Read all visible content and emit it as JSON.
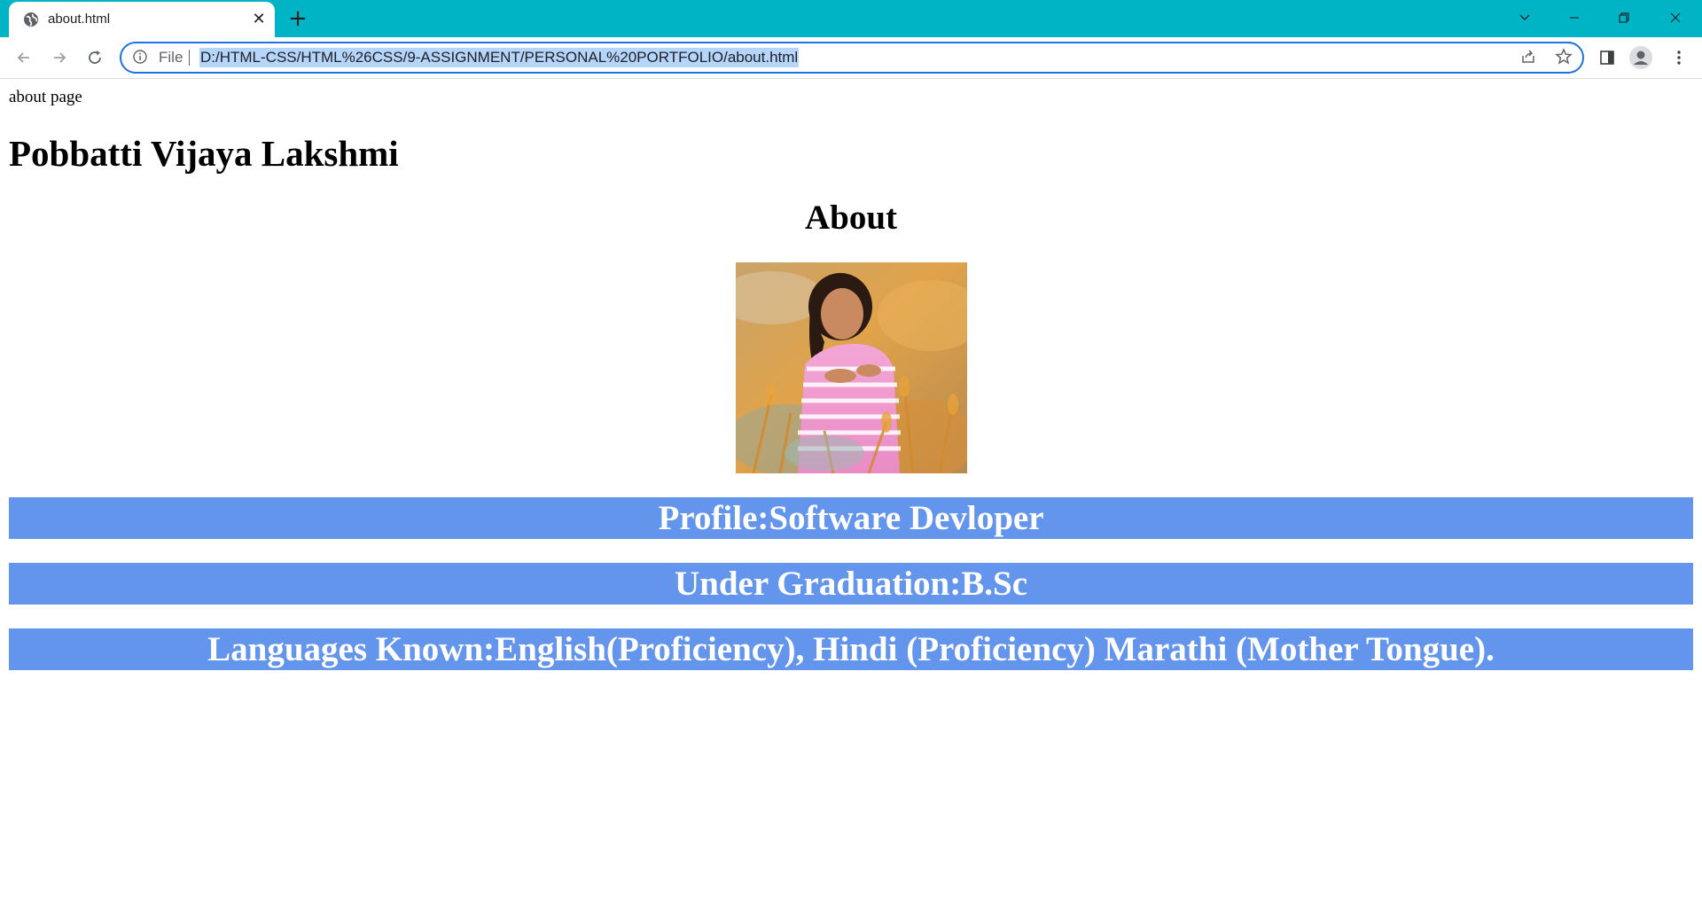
{
  "browser": {
    "tab_title": "about.html",
    "tab_close": "✕",
    "new_tab": "+",
    "address": {
      "scheme_label": "File",
      "url": "D:/HTML-CSS/HTML%26CSS/9-ASSIGNMENT/PERSONAL%20PORTFOLIO/about.html"
    },
    "window_controls": [
      "chevron-down",
      "minimize",
      "restore",
      "close"
    ],
    "toolbar_icons": [
      "share-icon",
      "star-icon",
      "side-panel-icon",
      "profile-icon",
      "menu-icon"
    ],
    "accent_color": "#00b4c5"
  },
  "page": {
    "top_text": "about page",
    "name": "Pobbatti Vijaya Lakshmi",
    "heading": "About",
    "photo": "woman-in-pink-striped-top-in-golden-field",
    "band_color": "#6495ed",
    "bands": [
      "Profile:Software Devloper",
      "Under Graduation:B.Sc",
      "Languages Known:English(Proficiency), Hindi (Proficiency) Marathi (Mother Tongue)."
    ]
  }
}
